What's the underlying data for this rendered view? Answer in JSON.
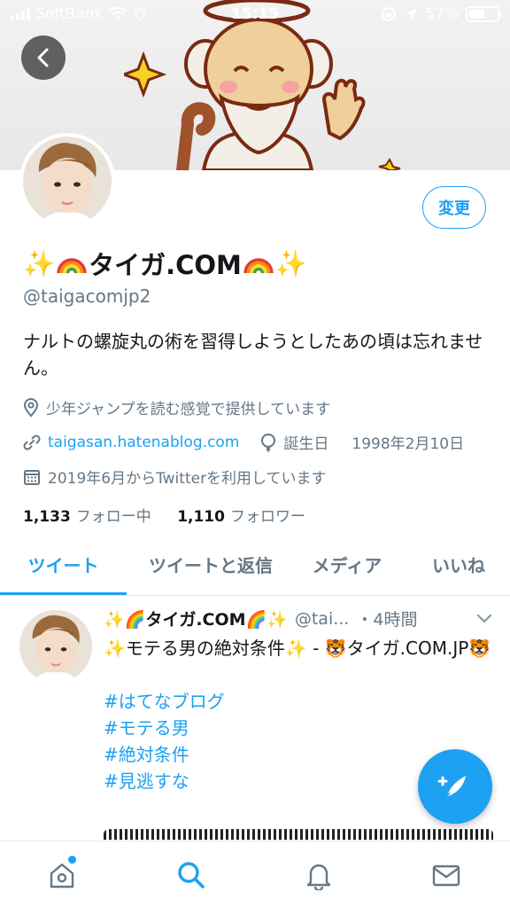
{
  "status_bar": {
    "carrier": "SoftBank",
    "time": "15:15",
    "battery": "57%",
    "battery_level": 0.57
  },
  "profile": {
    "edit_label": "変更",
    "name_text": "タイガ.COM",
    "handle": "@taigacomjp2",
    "bio": "ナルトの螺旋丸の術を習得しようとしたあの頃は忘れません。",
    "location": "少年ジャンプを読む感覚で提供しています",
    "website": "taigasan.hatenablog.com",
    "birthday_label": "誕生日",
    "birthday": "1998年2月10日",
    "joined": "2019年6月からTwitterを利用しています",
    "following_count": "1,133",
    "following_label": "フォロー中",
    "followers_count": "1,110",
    "followers_label": "フォロワー"
  },
  "tabs": [
    {
      "label": "ツイート",
      "active": true
    },
    {
      "label": "ツイートと返信",
      "active": false
    },
    {
      "label": "メディア",
      "active": false
    },
    {
      "label": "いいね",
      "active": false
    }
  ],
  "tweet": {
    "name": "✨🌈タイガ.COM🌈✨",
    "handle": "@tai...",
    "time": "・4時間",
    "line1": "✨モテる男の絶対条件✨ - 🐯タイガ.COM.JP🐯",
    "hashtags": [
      "#はてなブログ",
      "#モテる男",
      "#絶対条件",
      "#見逃すな"
    ]
  },
  "icons": {
    "back": "chevron-left-icon",
    "location": "location-pin-icon",
    "link": "link-icon",
    "birthday": "balloon-icon",
    "calendar": "calendar-icon",
    "compose": "compose-tweet-icon",
    "home": "home-icon",
    "search": "search-icon",
    "notifications": "bell-icon",
    "messages": "mail-icon"
  },
  "colors": {
    "accent": "#1da1f2",
    "secondary_text": "#657786",
    "primary_text": "#14171a"
  }
}
